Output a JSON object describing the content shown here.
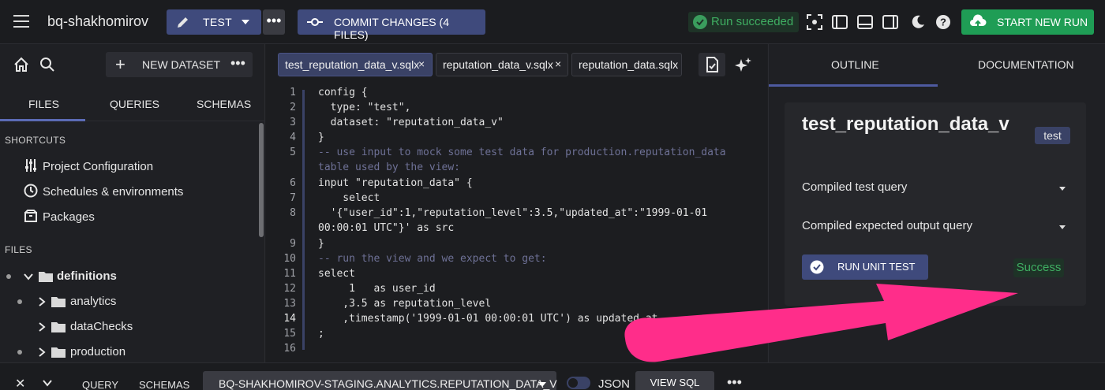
{
  "topbar": {
    "project_name": "bq-shakhomirov",
    "workspace_label": "TEST",
    "commit_label": "COMMIT CHANGES (4 FILES)",
    "run_status": "Run succeeded",
    "start_run_label": "START NEW RUN",
    "icons": [
      "menu-icon",
      "pencil-icon",
      "more-icon",
      "commit-icon",
      "check-circle-icon",
      "focus-icon",
      "panel-left-icon",
      "panel-bottom-icon",
      "panel-right-icon",
      "moon-icon",
      "help-icon",
      "cloud-upload-icon"
    ]
  },
  "left": {
    "new_dataset_label": "NEW DATASET",
    "tabs": [
      {
        "label": "FILES"
      },
      {
        "label": "QUERIES"
      },
      {
        "label": "SCHEMAS"
      }
    ],
    "shortcuts_header": "SHORTCUTS",
    "shortcuts": [
      {
        "label": "Project Configuration",
        "icon": "sliders-icon"
      },
      {
        "label": "Schedules & environments",
        "icon": "clock-icon"
      },
      {
        "label": "Packages",
        "icon": "package-icon"
      }
    ],
    "files_header": "FILES",
    "tree": [
      {
        "label": "definitions",
        "icon": "folder-icon"
      },
      {
        "label": "analytics",
        "icon": "folder-icon"
      },
      {
        "label": "dataChecks",
        "icon": "folder-icon"
      },
      {
        "label": "production",
        "icon": "folder-icon"
      }
    ]
  },
  "editor": {
    "tabs": [
      {
        "name": "test_reputation_data_v.sqlx",
        "close": "×"
      },
      {
        "name": "reputation_data_v.sqlx",
        "close": "×"
      },
      {
        "name": "reputation_data.sqlx"
      }
    ],
    "line_numbers": [
      "1",
      "2",
      "3",
      "4",
      "5",
      "6",
      "7",
      "8",
      "9",
      "10",
      "11",
      "12",
      "13",
      "14",
      "15",
      "16"
    ],
    "code_lines": [
      "config {",
      "  type: \"test\",",
      "  dataset: \"reputation_data_v\"",
      "}",
      "-- use input to mock some test data for production.reputation_data",
      "table used by the view:",
      "input \"reputation_data\" {",
      "    select",
      "  '{\"user_id\":1,\"reputation_level\":3.5,\"updated_at\":\"1999-01-01",
      "00:00:01 UTC\"}' as src",
      "}",
      "-- run the view and we expect to get:",
      "select",
      "     1   as user_id",
      "    ,3.5 as reputation_level",
      "    ,timestamp('1999-01-01 00:00:01 UTC') as updated_at",
      ";"
    ]
  },
  "right": {
    "tabs": [
      {
        "label": "OUTLINE"
      },
      {
        "label": "DOCUMENTATION"
      }
    ],
    "title": "test_reputation_data_v",
    "badge": "test",
    "accordion": [
      {
        "label": "Compiled test query"
      },
      {
        "label": "Compiled expected output query"
      }
    ],
    "run_unit_test_label": "RUN UNIT TEST",
    "result": "Success"
  },
  "bottom": {
    "close": "✕",
    "tabs": [
      {
        "label": "QUERY"
      },
      {
        "label": "SCHEMAS"
      }
    ],
    "selected_table": "BQ-SHAKHOMIROV-STAGING.ANALYTICS.REPUTATION_DATA_V",
    "json_label": "JSON",
    "view_sql_label": "VIEW SQL",
    "more": "•••"
  },
  "colors": {
    "accent": "#3f4a7c",
    "success": "#3fae62",
    "start_button": "#1f9d55",
    "arrow": "#ff2d8a"
  }
}
